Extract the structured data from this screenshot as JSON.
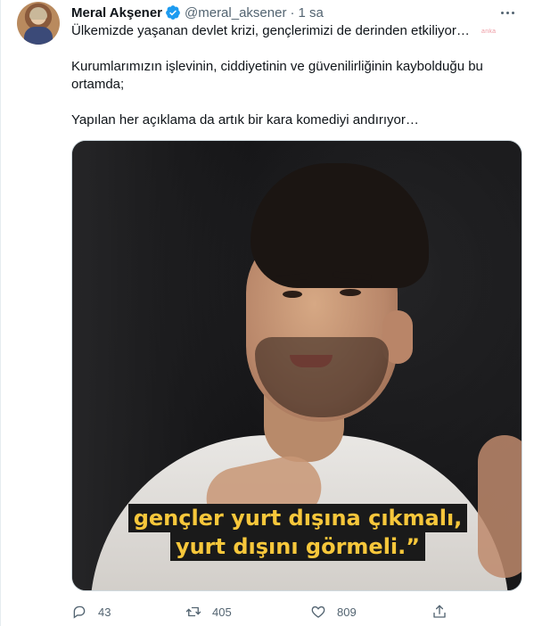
{
  "author": {
    "name": "Meral Akşener",
    "handle": "@meral_aksener",
    "separator": "·",
    "time": "1 sa"
  },
  "tweet": {
    "paragraphs": [
      "Ülkemizde yaşanan devlet krizi, gençlerimizi de derinden etkiliyor…",
      "Kurumlarımızın işlevinin, ciddiyetinin ve güvenilirliğinin kaybolduğu bu ortamda;",
      "Yapılan her açıklama da artık bir kara komediyi andırıyor…"
    ],
    "watermark": "anka"
  },
  "media": {
    "caption_line1": "gençler yurt dışına çıkmalı,",
    "caption_line2": "yurt dışını görmeli.”"
  },
  "actions": {
    "replies": "43",
    "retweets": "405",
    "likes": "809"
  },
  "icons": {
    "verified": "verified-badge-icon",
    "more": "more-options-icon",
    "reply": "reply-icon",
    "retweet": "retweet-icon",
    "like": "heart-icon",
    "share": "share-icon"
  },
  "colors": {
    "verified": "#1d9bf0",
    "secondary_text": "#536471",
    "caption_text": "#f7c73b"
  }
}
